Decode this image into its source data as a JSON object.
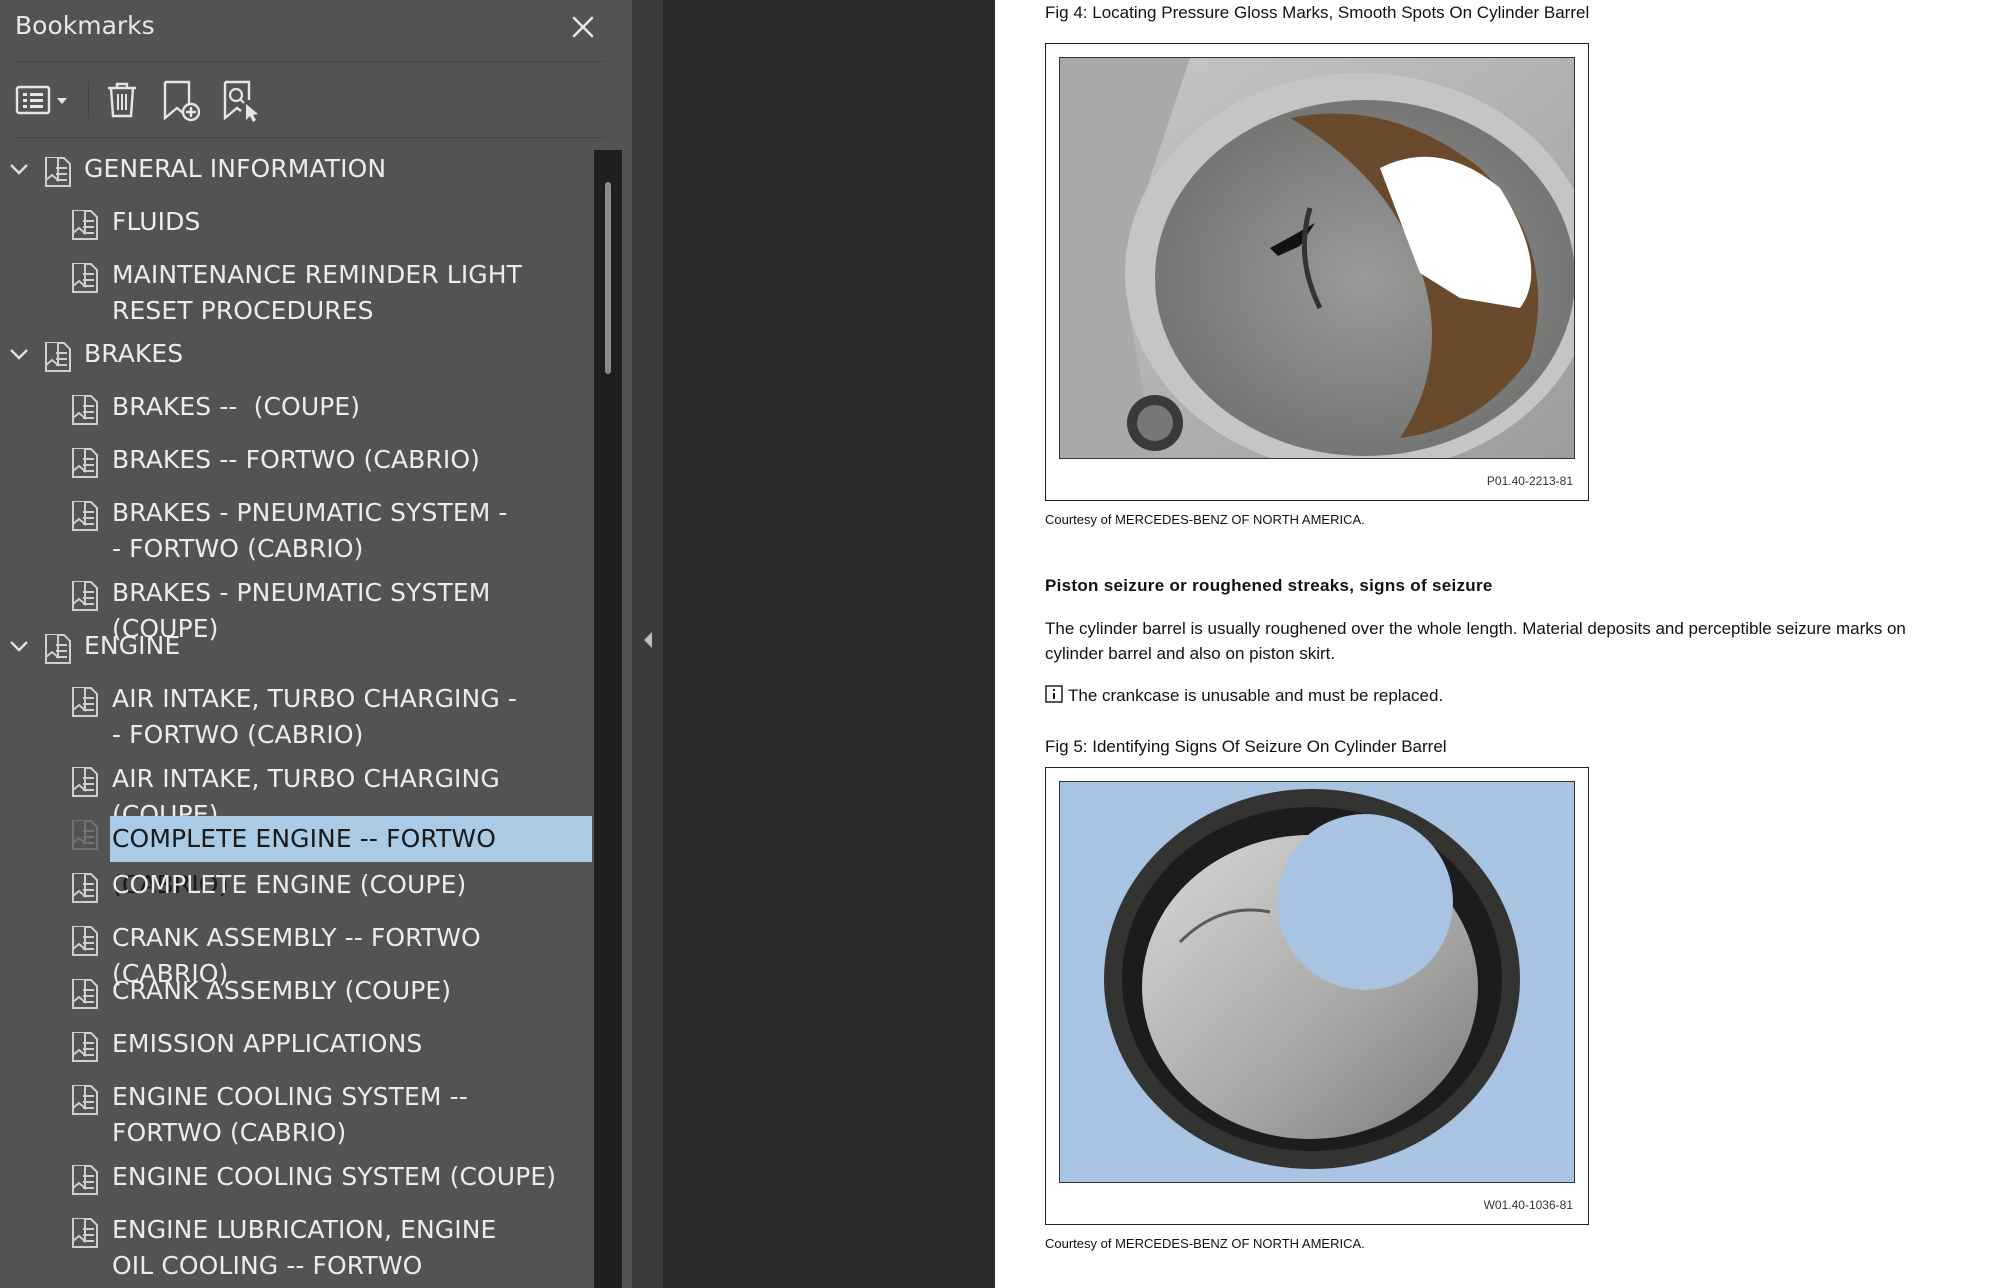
{
  "bookmarks_panel": {
    "title": "Bookmarks",
    "toolbar": {
      "options_icon": "bookmark-options-icon",
      "delete_icon": "trash-icon",
      "add_icon": "add-bookmark-icon",
      "find_icon": "find-bookmark-icon"
    },
    "items": [
      {
        "label": "GENERAL INFORMATION",
        "level": 0,
        "expanded": true
      },
      {
        "label": "FLUIDS",
        "level": 1
      },
      {
        "label": "MAINTENANCE REMINDER LIGHT RESET PROCEDURES",
        "level": 1
      },
      {
        "label": "BRAKES",
        "level": 0,
        "expanded": true
      },
      {
        "label": "BRAKES --  (COUPE)",
        "level": 1
      },
      {
        "label": "BRAKES -- FORTWO (CABRIO)",
        "level": 1
      },
      {
        "label": "BRAKES - PNEUMATIC SYSTEM -- FORTWO (CABRIO)",
        "level": 1
      },
      {
        "label": "BRAKES - PNEUMATIC SYSTEM (COUPE)",
        "level": 1
      },
      {
        "label": "ENGINE",
        "level": 0,
        "expanded": true
      },
      {
        "label": "AIR INTAKE, TURBO CHARGING -- FORTWO (CABRIO)",
        "level": 1
      },
      {
        "label": "AIR INTAKE, TURBO CHARGING (COUPE)",
        "level": 1
      },
      {
        "label": "COMPLETE ENGINE -- FORTWO (CABRIO)",
        "level": 1,
        "selected": true
      },
      {
        "label": "COMPLETE ENGINE (COUPE)",
        "level": 1
      },
      {
        "label": "CRANK ASSEMBLY -- FORTWO (CABRIO)",
        "level": 1
      },
      {
        "label": "CRANK ASSEMBLY (COUPE)",
        "level": 1
      },
      {
        "label": "EMISSION APPLICATIONS",
        "level": 1
      },
      {
        "label": "ENGINE COOLING SYSTEM -- FORTWO (CABRIO)",
        "level": 1
      },
      {
        "label": "ENGINE COOLING SYSTEM (COUPE)",
        "level": 1
      },
      {
        "label": "ENGINE LUBRICATION, ENGINE OIL COOLING -- FORTWO (CABRIO)",
        "level": 1
      }
    ]
  },
  "document": {
    "fig4": {
      "caption": "Fig 4: Locating Pressure Gloss Marks, Smooth Spots On Cylinder Barrel",
      "code": "P01.40-2213-81",
      "courtesy": "Courtesy of MERCEDES-BENZ OF NORTH AMERICA."
    },
    "heading": "Piston seizure or roughened streaks, signs of seizure",
    "paragraph": "The cylinder barrel is usually roughened over the whole length. Material deposits and perceptible seizure marks on cylinder barrel and also on piston skirt.",
    "info_text": "The crankcase is unusable and must be replaced.",
    "fig5": {
      "caption": "Fig 5: Identifying Signs Of Seizure On Cylinder Barrel",
      "code": "W01.40-1036-81",
      "courtesy": "Courtesy of MERCEDES-BENZ OF NORTH AMERICA."
    }
  },
  "colors": {
    "panel_bg": "#535353",
    "selection": "#a9cbe6",
    "page_bg": "#ffffff",
    "viewer_bg": "#2b2b2b"
  }
}
